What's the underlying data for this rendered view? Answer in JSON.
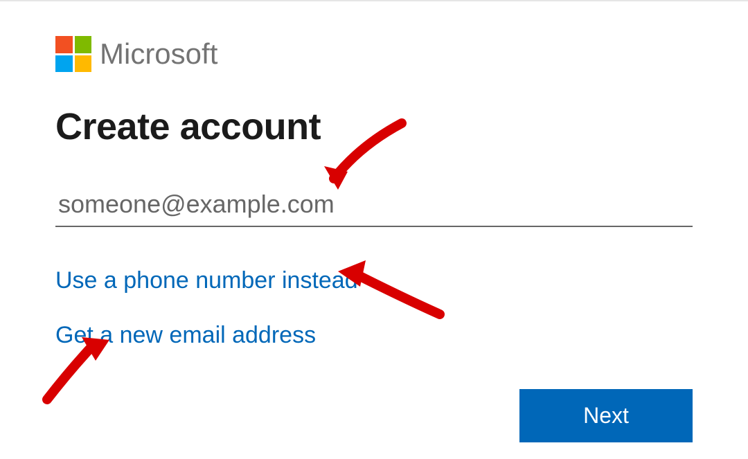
{
  "brand": {
    "name": "Microsoft"
  },
  "form": {
    "heading": "Create account",
    "email_placeholder": "someone@example.com",
    "email_value": "",
    "link_phone": "Use a phone number instead",
    "link_new_email": "Get a new email address",
    "next_label": "Next"
  },
  "colors": {
    "ms_red": "#f25022",
    "ms_green": "#7fba00",
    "ms_blue": "#00a4ef",
    "ms_yellow": "#ffb900",
    "primary": "#0067b8",
    "text_muted": "#737373",
    "arrow": "#d80000"
  }
}
